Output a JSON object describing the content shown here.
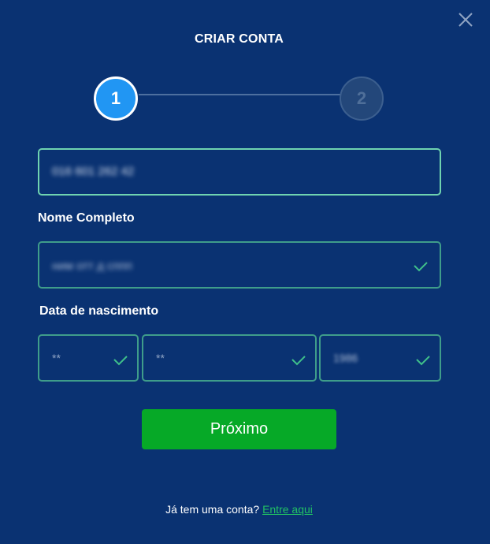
{
  "header": {
    "title": "CRIAR CONTA"
  },
  "stepper": {
    "steps": [
      {
        "label": "1",
        "state": "active"
      },
      {
        "label": "2",
        "state": "inactive"
      }
    ]
  },
  "form": {
    "phone": {
      "value": "016 601 262 42"
    },
    "full_name": {
      "label": "Nome Completo",
      "value": "ним отт д сппп"
    },
    "birth_date": {
      "label": "Data de nascimento",
      "day": "**",
      "month": "**",
      "year": "1986"
    },
    "next_button": "Próximo"
  },
  "footer": {
    "prompt": "Já tem uma conta?",
    "link": "Entre aqui"
  },
  "colors": {
    "background": "#0a3272",
    "accent_green": "#06a927",
    "field_border": "#3f9d8a",
    "step_active": "#2196f3",
    "link_green": "#21c064"
  },
  "icons": {
    "close": "close-icon",
    "check": "check-icon"
  }
}
